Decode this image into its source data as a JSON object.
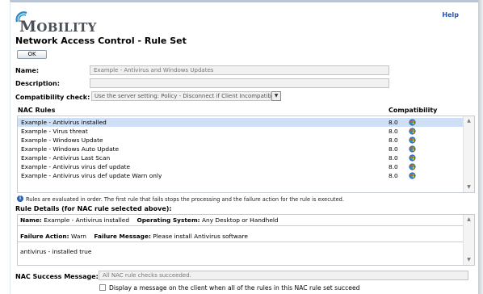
{
  "header": {
    "help_label": "Help",
    "logo_text_initial": "M",
    "logo_text_rest": "OBILITY",
    "page_title": "Network Access Control - Rule Set"
  },
  "toolbar": {
    "ok_label": "OK"
  },
  "form": {
    "name_label": "Name:",
    "name_value": "Example - Antivirus and Windows Updates",
    "description_label": "Description:",
    "description_value": "",
    "compat_label": "Compatibility check:",
    "compat_value": "Use the server setting: Policy - Disconnect if Client Incompatible"
  },
  "rules": {
    "col_rules": "NAC Rules",
    "col_compat": "Compatibility",
    "items": [
      {
        "name": "Example - Antivirus installed",
        "version": "8.0",
        "selected": true
      },
      {
        "name": "Example - Virus threat",
        "version": "8.0",
        "selected": false
      },
      {
        "name": "Example - Windows Update",
        "version": "8.0",
        "selected": false
      },
      {
        "name": "Example - Windows Auto Update",
        "version": "8.0",
        "selected": false
      },
      {
        "name": "Example - Antivirus Last Scan",
        "version": "8.0",
        "selected": false
      },
      {
        "name": "Example - Antivirus virus def update",
        "version": "8.0",
        "selected": false
      },
      {
        "name": "Example - Antivirus virus def update Warn only",
        "version": "8.0",
        "selected": false
      }
    ],
    "info_text": "Rules are evaluated in order. The first rule that fails stops the processing and the failure action for the rule is executed."
  },
  "details": {
    "heading": "Rule Details (for NAC rule selected above):",
    "name_label": "Name:",
    "name_value": "Example - Antivirus installed",
    "os_label": "Operating System:",
    "os_value": "Any Desktop or Handheld",
    "failure_action_label": "Failure Action:",
    "failure_action_value": "Warn",
    "failure_message_label": "Failure Message:",
    "failure_message_value": "Please install Antivirus software",
    "expression": "antivirus - installed true"
  },
  "success": {
    "label": "NAC Success Message:",
    "value": "All NAC rule checks succeeded.",
    "checkbox_label": "Display a message on the client when all of the rules in this NAC rule set succeed",
    "checkbox_checked": false
  },
  "colors": {
    "selected_row": "#cfe0f6",
    "link": "#2a55a5",
    "border": "#c6cbd1"
  },
  "icons": {
    "os": "windows-logo-icon",
    "info": "info-icon",
    "scroll_up": "scroll-up-arrow-icon",
    "scroll_down": "scroll-down-arrow-icon",
    "dropdown": "dropdown-arrow-icon"
  }
}
